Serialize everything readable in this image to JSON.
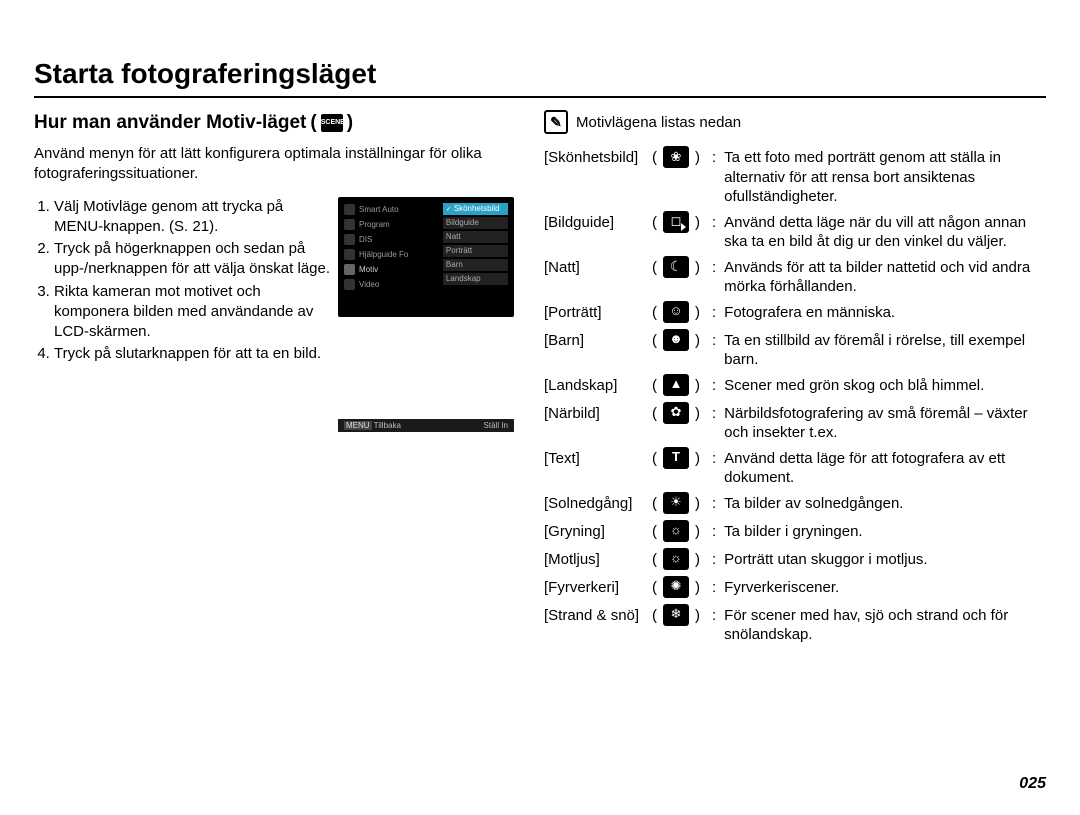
{
  "title": "Starta fotograferingsläget",
  "page_number": "025",
  "left": {
    "subhead_prefix": "Hur man använder Motiv-läget",
    "scene_icon_label": "SCENE",
    "intro": "Använd menyn för att lätt konfigurera optimala inställningar för olika fotograferingssituationer.",
    "steps": [
      "Välj Motivläge genom att trycka på MENU-knappen. (S. 21).",
      "Tryck på högerknappen och sedan på upp-/nerknappen för att välja önskat läge.",
      "Rikta kameran mot motivet och komponera bilden med användande av LCD-skärmen.",
      "Tryck på slutarknappen för att ta en bild."
    ]
  },
  "lcd": {
    "left_rows": [
      "Smart Auto",
      "Program",
      "DIS",
      "Hjälpguide Fo",
      "Motiv",
      "Video"
    ],
    "selected_left_index": 4,
    "right_items": [
      "Skönhetsbild",
      "Bildguide",
      "Natt",
      "Porträtt",
      "Barn",
      "Landskap"
    ],
    "selected_right_index": 0,
    "foot_left_icon": "MENU",
    "foot_left": "Tillbaka",
    "foot_right": "Ställ In"
  },
  "right": {
    "note_icon": "✎",
    "note_text": "Motivlägena listas nedan",
    "modes": [
      {
        "label": "[Skönhetsbild]",
        "icon": "i-beauty",
        "desc": "Ta ett foto med porträtt genom att ställa in alternativ för att rensa bort ansiktenas ofullständigheter."
      },
      {
        "label": "[Bildguide]",
        "icon": "i-guide",
        "desc": "Använd detta läge när du vill att någon annan ska ta en bild åt dig ur den vinkel du väljer."
      },
      {
        "label": "[Natt]",
        "icon": "i-night",
        "desc": "Används för att ta bilder nattetid och vid andra mörka förhållanden."
      },
      {
        "label": "[Porträtt]",
        "icon": "i-portrait",
        "desc": "Fotografera en människa."
      },
      {
        "label": "[Barn]",
        "icon": "i-child",
        "desc": "Ta en stillbild av föremål i rörelse, till exempel barn."
      },
      {
        "label": "[Landskap]",
        "icon": "i-land",
        "desc": "Scener med grön skog och blå himmel."
      },
      {
        "label": "[Närbild]",
        "icon": "i-macro",
        "desc": "Närbildsfotografering av små föremål – växter och insekter t.ex."
      },
      {
        "label": "[Text]",
        "icon": "i-text",
        "desc": "Använd detta läge för att fotografera av ett dokument."
      },
      {
        "label": "[Solnedgång]",
        "icon": "i-sunset",
        "desc": "Ta bilder av solnedgången."
      },
      {
        "label": "[Gryning]",
        "icon": "i-dawn",
        "desc": "Ta bilder i gryningen."
      },
      {
        "label": "[Motljus]",
        "icon": "i-backl",
        "desc": "Porträtt utan skuggor i motljus."
      },
      {
        "label": "[Fyrverkeri]",
        "icon": "i-fire",
        "desc": "Fyrverkeriscener."
      },
      {
        "label": "[Strand & snö]",
        "icon": "i-beach",
        "desc": "För scener med hav, sjö och strand och för snölandskap."
      }
    ]
  }
}
